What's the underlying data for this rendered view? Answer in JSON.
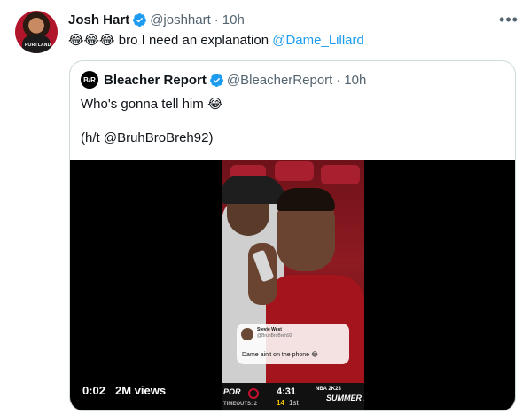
{
  "tweet": {
    "author_name": "Josh Hart",
    "author_handle": "@joshhart",
    "time": "10h",
    "dot": "·",
    "more_icon_text": "•••",
    "emojis": "😂😂😂",
    "text": " bro I need an explanation ",
    "mention": "@Dame_Lillard",
    "avatar_jersey_text": "PORTLAND"
  },
  "quote": {
    "logo_text": "B/R",
    "author_name": "Bleacher Report",
    "author_handle": "@BleacherReport",
    "time": "10h",
    "dot": "·",
    "text_line1": "Who's gonna tell him ",
    "text_emoji": "😂",
    "text_line2": "(h/t @BruhBroBreh92)"
  },
  "video": {
    "elapsed": "0:02",
    "views": "2M views",
    "overlay": {
      "name": "Stevie West",
      "handle": "@BruhBroBreh92",
      "text": "Dame ain't on the phone 😂"
    },
    "scorebug": {
      "team": "POR",
      "timeouts": "TIMEOUTS: 2",
      "clock": "4:31",
      "shot_clock": "14",
      "period": "1st",
      "brand_top": "NBA 2K23",
      "brand_main": "SUMMER LEA"
    }
  },
  "colors": {
    "accent": "#1d9bf0",
    "muted": "#536471",
    "border": "#cfd9de"
  }
}
